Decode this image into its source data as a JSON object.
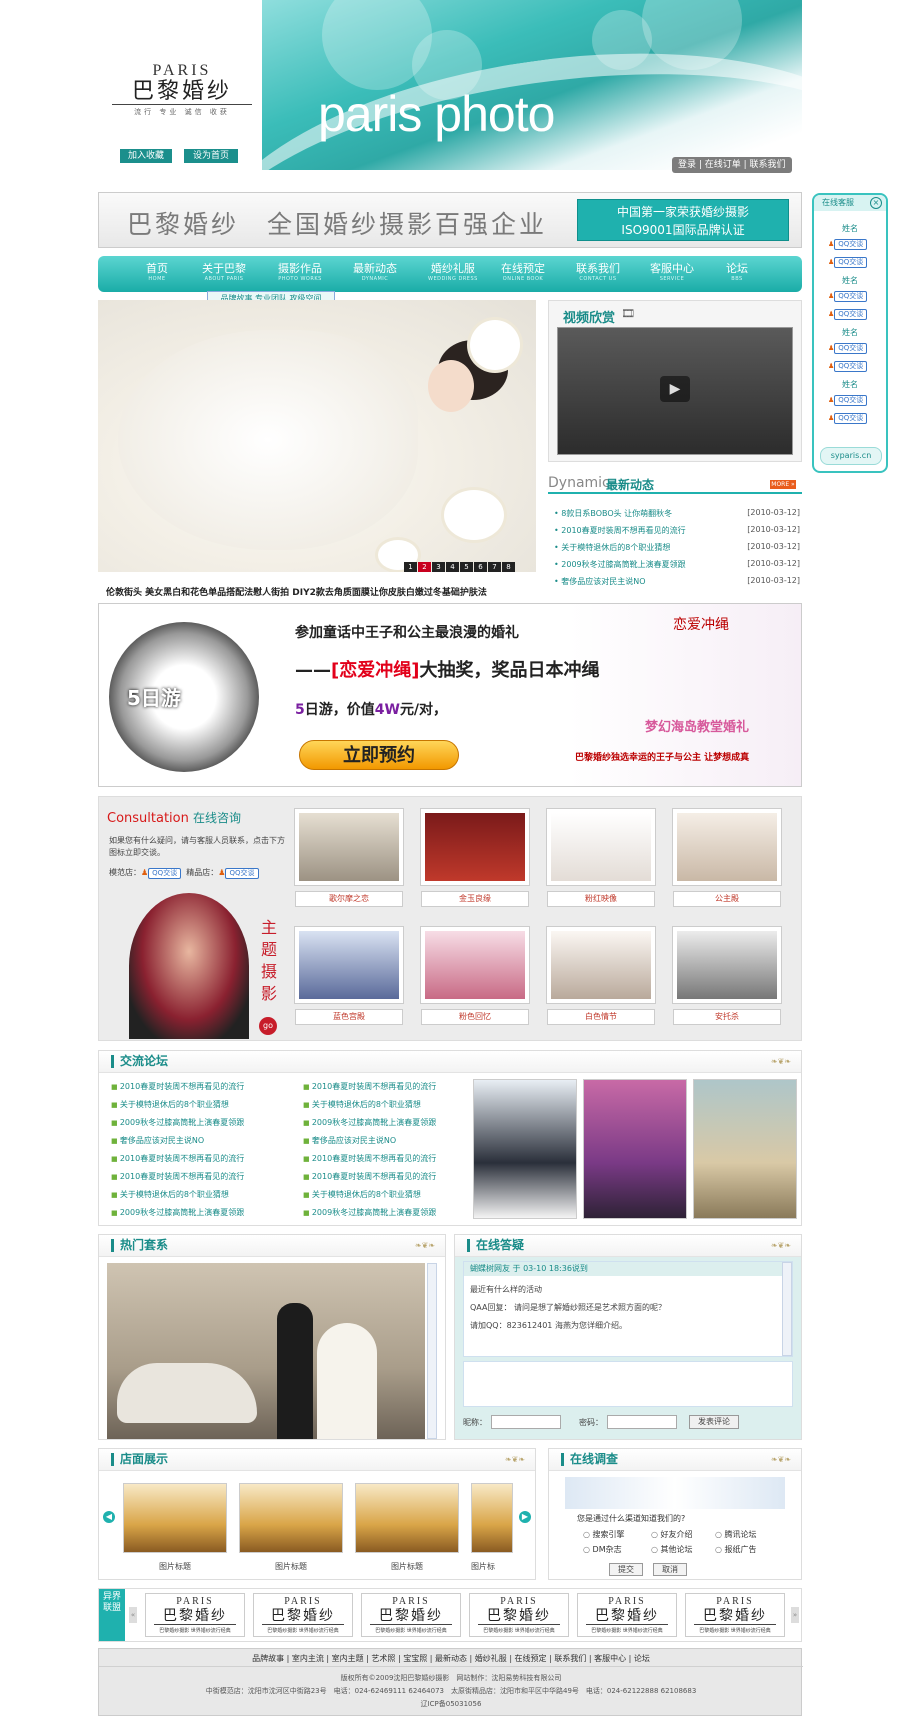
{
  "header": {
    "logo_paris": "PARIS",
    "logo_cn": "巴黎婚纱",
    "logo_tagline": "流行 专业 诚信 收获",
    "photo_text": "paris photo",
    "add_favorite": "加入收藏",
    "set_home": "设为首页",
    "top_links": "登录 | 在线订单 | 联系我们"
  },
  "slogan": {
    "text": "巴黎婚纱　全国婚纱摄影百强企业",
    "cert_line1": "中国第一家荣获婚纱摄影",
    "cert_line2": "ISO9001国际品牌认证"
  },
  "nav": {
    "items": [
      {
        "cn": "首页",
        "en": "HOME"
      },
      {
        "cn": "关于巴黎",
        "en": "ABOUT PARIS"
      },
      {
        "cn": "摄影作品",
        "en": "PHOTO WORKS"
      },
      {
        "cn": "最新动态",
        "en": "DYNAMIC"
      },
      {
        "cn": "婚纱礼服",
        "en": "WEDDING DRESS"
      },
      {
        "cn": "在线预定",
        "en": "ONLINE BOOK"
      },
      {
        "cn": "联系我们",
        "en": "CONTACT US"
      },
      {
        "cn": "客服中心",
        "en": "SERVICE"
      },
      {
        "cn": "论坛",
        "en": "BBS"
      }
    ],
    "submenu": "品牌故事 专业团队 攻级空间"
  },
  "hero": {
    "pages": [
      "1",
      "2",
      "3",
      "4",
      "5",
      "6",
      "7",
      "8"
    ],
    "active_page": "2",
    "caption": "伦敦街头 美女黑白和花色单品搭配法慰人街拍 DIY2款去角质面膜让你皮肤白嫩过冬基础护肤法"
  },
  "video": {
    "title": "视频欣赏"
  },
  "dynamic": {
    "title_en": "Dynamic",
    "title_cn": "最新动态",
    "more": "MORE »",
    "items": [
      {
        "text": "• 8款日系BOBO头 让你萌翻秋冬",
        "date": "[2010-03-12]"
      },
      {
        "text": "• 2010春夏时装周不想再看见的流行",
        "date": "[2010-03-12]"
      },
      {
        "text": "• 关于模特退休后的8个职业猜想",
        "date": "[2010-03-12]"
      },
      {
        "text": "• 2009秋冬过膝高筒靴上演春夏领跟",
        "date": "[2010-03-12]"
      },
      {
        "text": "• 奢侈品应该对民主说NO",
        "date": "[2010-03-12]"
      }
    ]
  },
  "promo": {
    "circle_text": "5日游",
    "line1": "参加童话中王子和公主最浪漫的婚礼",
    "line2_prefix": "——",
    "line2_red": "[恋爱冲绳]",
    "line2_suffix": "大抽奖，奖品日本冲绳",
    "line3_a": "5",
    "line3_b": "日游，价值",
    "line3_c": "4W",
    "line3_d": "元/对，",
    "book_button": "立即预约",
    "right_title": "恋爱冲绳",
    "right_subtitle": "梦幻海岛教堂婚礼",
    "right_slogan": "巴黎婚纱独选幸运的王子与公主 让梦想成真"
  },
  "consult": {
    "title_en": "Consultation",
    "title_cn": "在线咨询",
    "text": "如果您有什么疑问，请与客服人员联系，点击下方图标立即交谈。",
    "shop1": "模范店：",
    "shop2": "精品店：",
    "qq_label": "QQ交谈",
    "vertical_title": "主题摄影",
    "go": "go"
  },
  "themes": [
    {
      "caption": "歌尔摩之恋"
    },
    {
      "caption": "金玉良缘"
    },
    {
      "caption": "粉红映像"
    },
    {
      "caption": "公主殿"
    },
    {
      "caption": "蓝色宫殿"
    },
    {
      "caption": "粉色回忆"
    },
    {
      "caption": "白色情节"
    },
    {
      "caption": "安托杀"
    }
  ],
  "forum": {
    "title": "交流论坛",
    "col1": [
      "2010春夏时装周不想再看见的流行",
      "关于模特退休后的8个职业猜想",
      "2009秋冬过膝高筒靴上演春夏领跟",
      "奢侈品应该对民主说NO",
      "2010春夏时装周不想再看见的流行",
      "2010春夏时装周不想再看见的流行",
      "关于模特退休后的8个职业猜想",
      "2009秋冬过膝高筒靴上演春夏领跟"
    ],
    "col2": [
      "2010春夏时装周不想再看见的流行",
      "关于模特退休后的8个职业猜想",
      "2009秋冬过膝高筒靴上演春夏领跟",
      "奢侈品应该对民主说NO",
      "2010春夏时装周不想再看见的流行",
      "2010春夏时装周不想再看见的流行",
      "关于模特退休后的8个职业猜想",
      "2009秋冬过膝高筒靴上演春夏领跟"
    ]
  },
  "hot": {
    "title": "热门套系"
  },
  "answer": {
    "title": "在线答疑",
    "head": "蝴蝶树网友 于 03-10 18:36说到",
    "q": "最近有什么样的活动",
    "a": "QAA回复： 请问是想了解婚纱照还是艺术照方面的呢？",
    "contact": "请加QQ：823612401 海燕为您详细介绍。",
    "nick_label": "昵称：",
    "pwd_label": "密码：",
    "submit": "发表评论"
  },
  "store": {
    "title": "店面展示",
    "captions": [
      "图片标题",
      "图片标题",
      "图片标题",
      "图片标"
    ]
  },
  "survey": {
    "title": "在线调查",
    "question": "您是通过什么渠道知道我们的?",
    "options": [
      "搜索引擎",
      "好友介绍",
      "腾讯论坛",
      "DM杂志",
      "其他论坛",
      "报纸广告"
    ],
    "submit": "提交",
    "cancel": "取消"
  },
  "union": {
    "label": "异界联盟",
    "logo_paris": "PARIS",
    "logo_cn": "巴黎婚纱",
    "logo_sub": "巴黎婚纱摄影 世界婚纱流行经典"
  },
  "footer": {
    "nav": "品牌故事 | 室内主流 | 室内主题 | 艺术照 | 宝宝照 | 最新动态 | 婚纱礼服 | 在线预定 | 联系我们 | 客服中心 | 论坛",
    "copyright": "版权所有©2009沈阳巴黎婚纱摄影　网站制作：沈阳易势科技有限公司",
    "address": "中街模范店：沈阳市沈河区中街路23号　电话：024-62469111 62464073　太原街精品店：沈阳市和平区中华路49号　电话：024-62122888 62108683",
    "icp": "辽ICP备05031056"
  },
  "service": {
    "title": "在线客服",
    "name_label": "姓名",
    "qq_label": "QQ交谈",
    "site": "syparis.cn"
  },
  "colors": {
    "accent": "#1fb1ae",
    "nav_top": "#5bd5d1",
    "red": "#e2001a"
  }
}
